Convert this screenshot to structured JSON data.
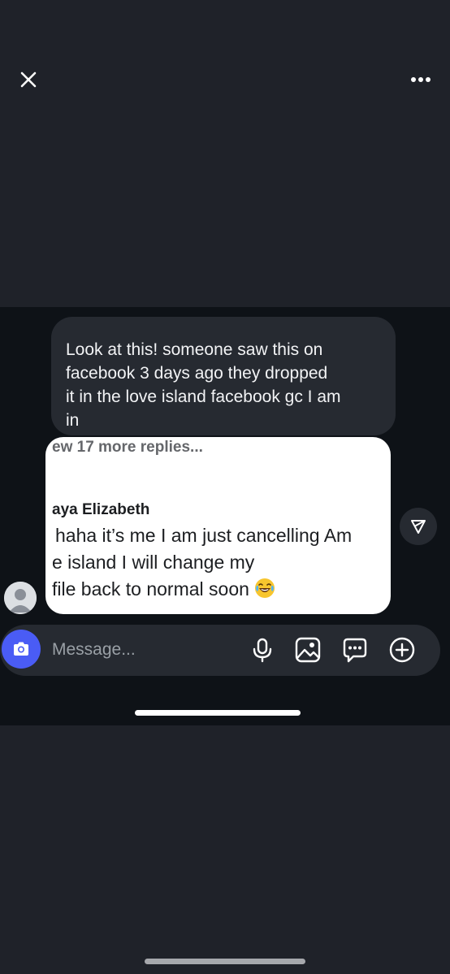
{
  "viewer": {
    "close_icon": "close-icon",
    "more_icon": "more-horizontal-icon"
  },
  "message": {
    "lines": [
      "Look at this! someone saw this on",
      "facebook 3 days ago they dropped",
      "it in the love island facebook gc I am",
      "in"
    ]
  },
  "facebook_comment": {
    "more_replies": "ew 17 more replies...",
    "commenter": "aya Elizabeth",
    "lines": [
      "haha it’s me I am just cancelling Am",
      "e island I will change my",
      "file back to normal soon"
    ],
    "emoji": "laughing-crying-emoji"
  },
  "share": {
    "icon": "send-icon"
  },
  "composer": {
    "placeholder": "Message...",
    "camera_icon": "camera-icon",
    "mic_icon": "microphone-icon",
    "gallery_icon": "gallery-icon",
    "sticker_icon": "sticker-icon",
    "plus_icon": "plus-circle-icon"
  },
  "colors": {
    "background": "#1f2229",
    "screenshot_background": "#0e1217",
    "bubble": "#262a31",
    "camera_accent": "#4a5cf5"
  }
}
